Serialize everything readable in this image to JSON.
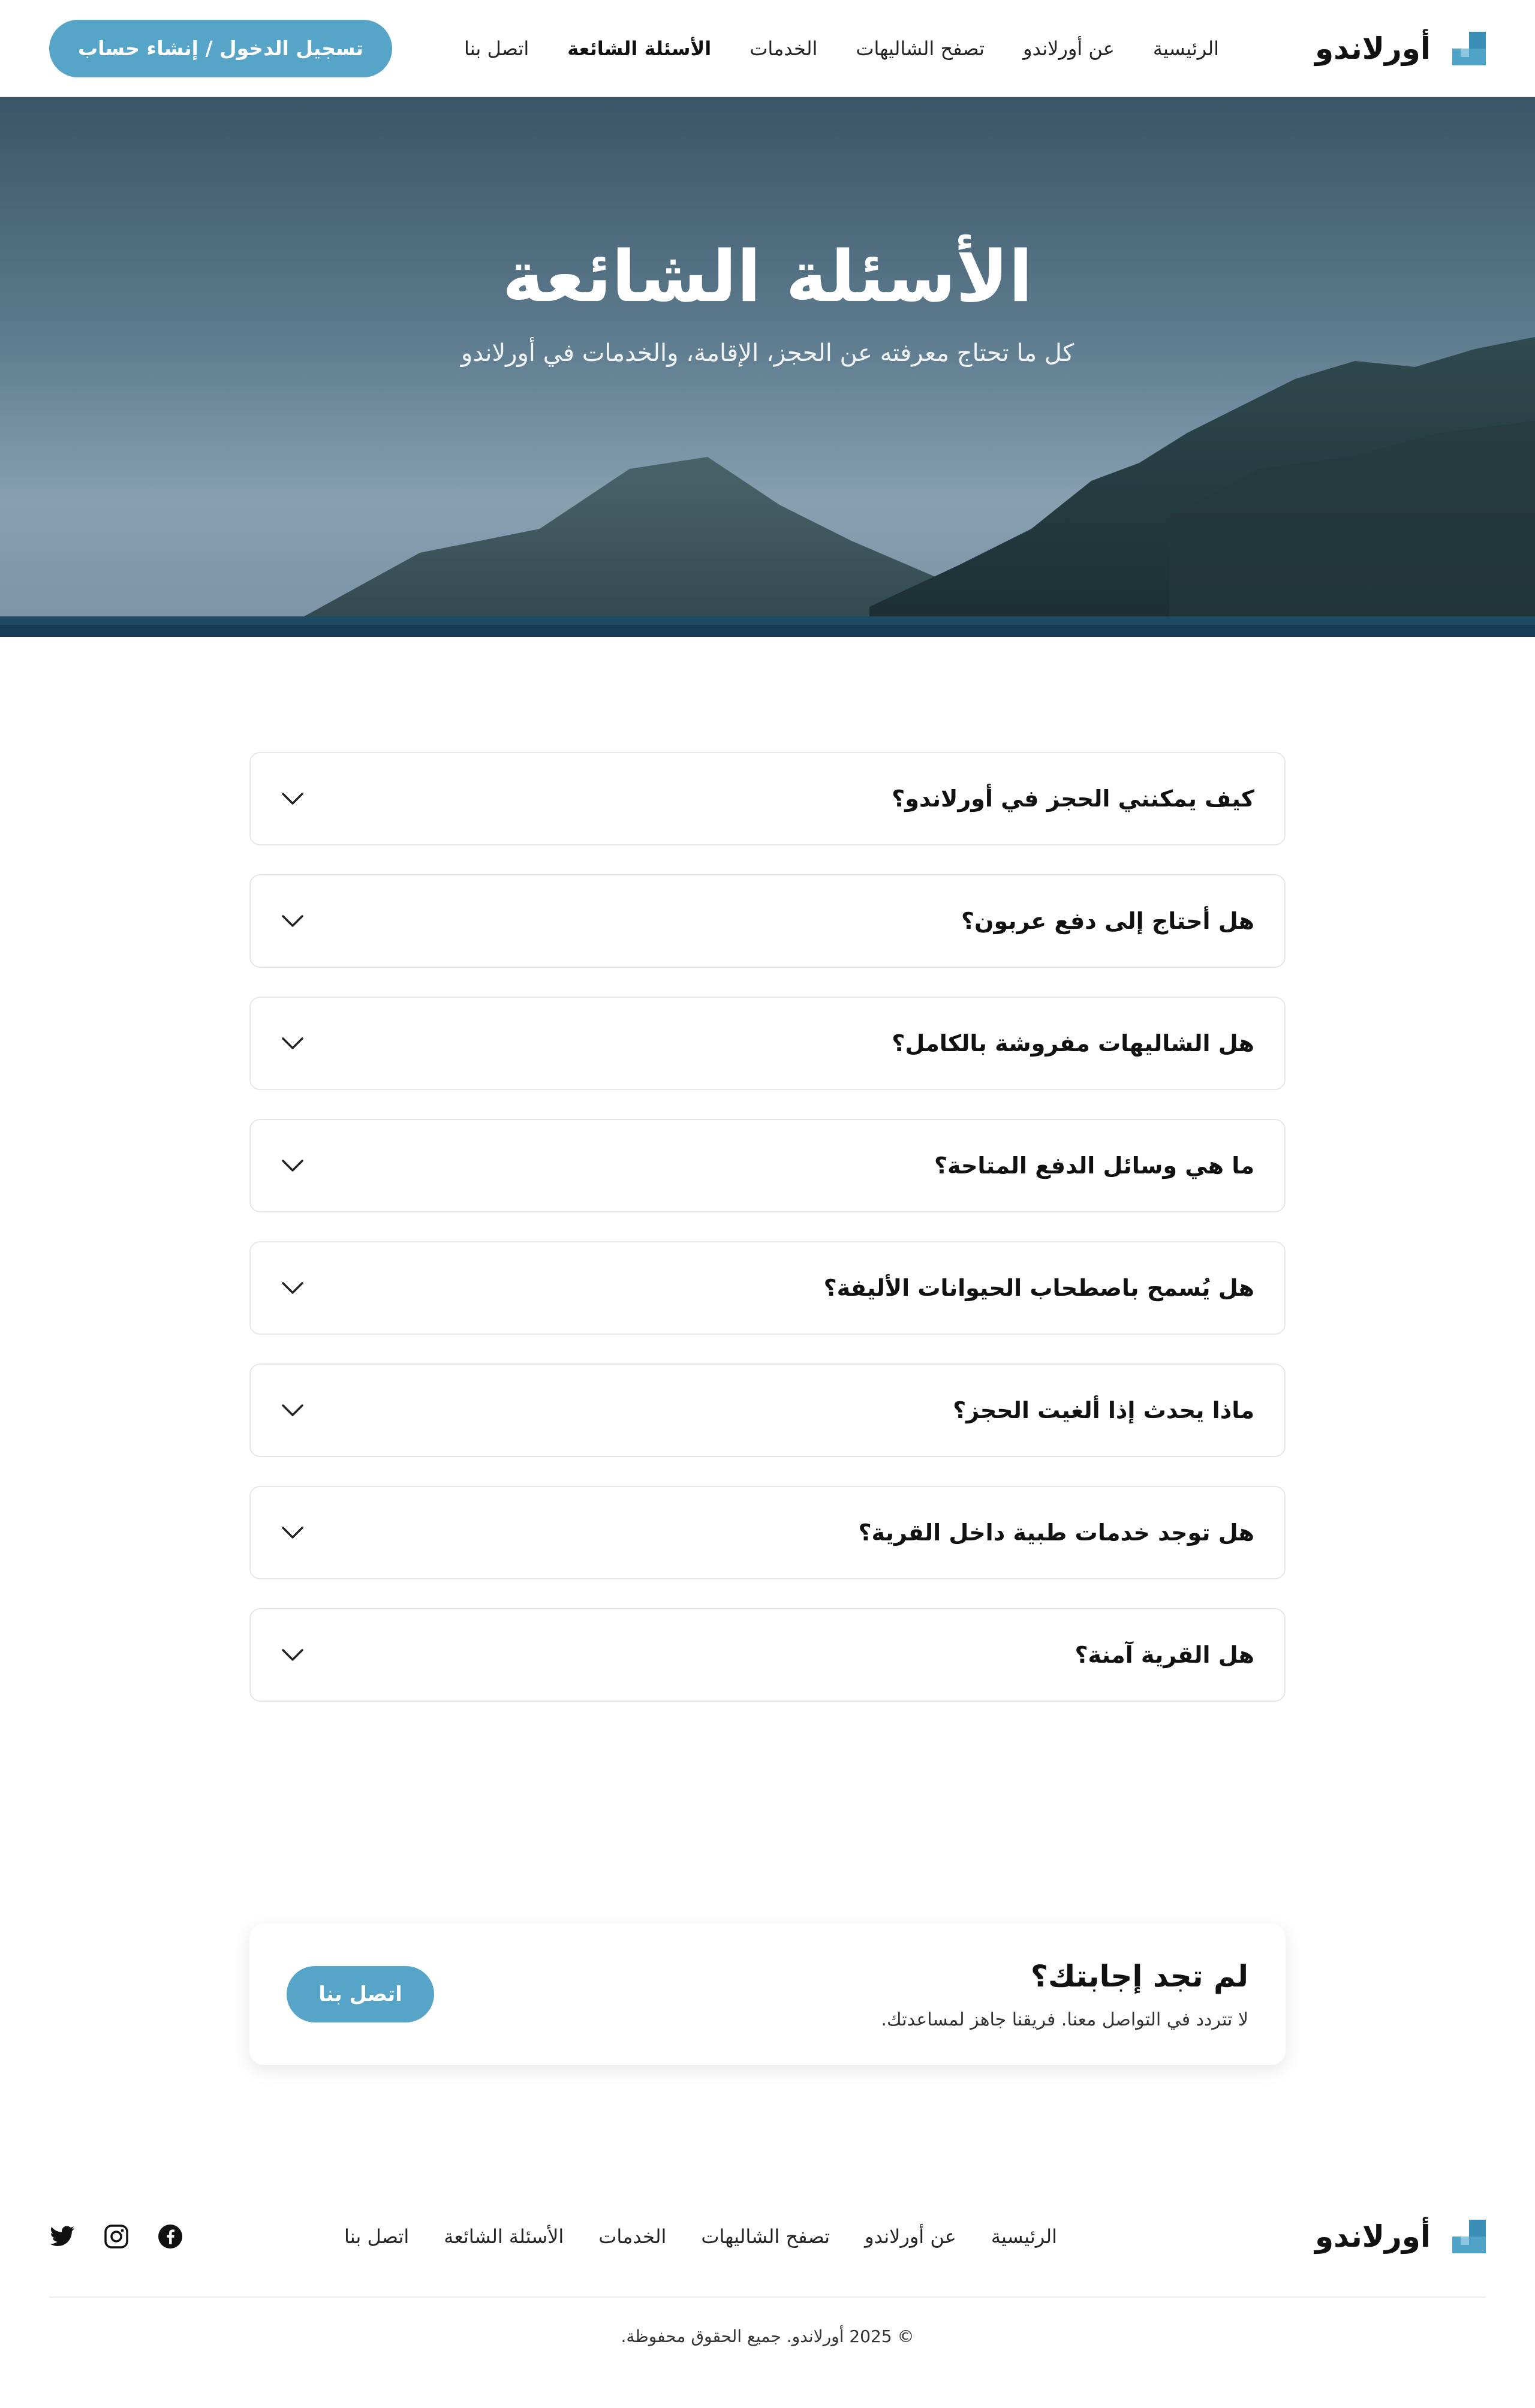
{
  "brand": {
    "name": "أورلاندو",
    "accent": "#56a5c8"
  },
  "nav": {
    "items": [
      "الرئيسية",
      "عن أورلاندو",
      "تصفح الشاليهات",
      "الخدمات",
      "الأسئلة الشائعة",
      "اتصل بنا"
    ],
    "active": "الأسئلة الشائعة",
    "login_label": "تسجيل الدخول / إنشاء حساب"
  },
  "hero": {
    "title": "الأسئلة الشائعة",
    "subtitle": "كل ما تحتاج معرفته عن الحجز، الإقامة، والخدمات في أورلاندو"
  },
  "faq": {
    "items": [
      "كيف يمكنني الحجز في أورلاندو؟",
      "هل أحتاج إلى دفع عربون؟",
      "هل الشاليهات مفروشة بالكامل؟",
      "ما هي وسائل الدفع المتاحة؟",
      "هل يُسمح باصطحاب الحيوانات الأليفة؟",
      "ماذا يحدث إذا ألغيت الحجز؟",
      "هل توجد خدمات طبية داخل القرية؟",
      "هل القرية آمنة؟"
    ]
  },
  "cta": {
    "title": "لم تجد إجابتك؟",
    "subtitle": "لا تتردد في التواصل معنا. فريقنا جاهز لمساعدتك.",
    "button": "اتصل بنا"
  },
  "footer": {
    "brand": "أورلاندو",
    "links": [
      "الرئيسية",
      "عن أورلاندو",
      "تصفح الشاليهات",
      "الخدمات",
      "الأسئلة الشائعة",
      "اتصل بنا"
    ],
    "social": [
      "facebook-icon",
      "instagram-icon",
      "twitter-icon"
    ],
    "copyright": "© 2025 أورلاندو. جميع الحقوق محفوظة."
  }
}
